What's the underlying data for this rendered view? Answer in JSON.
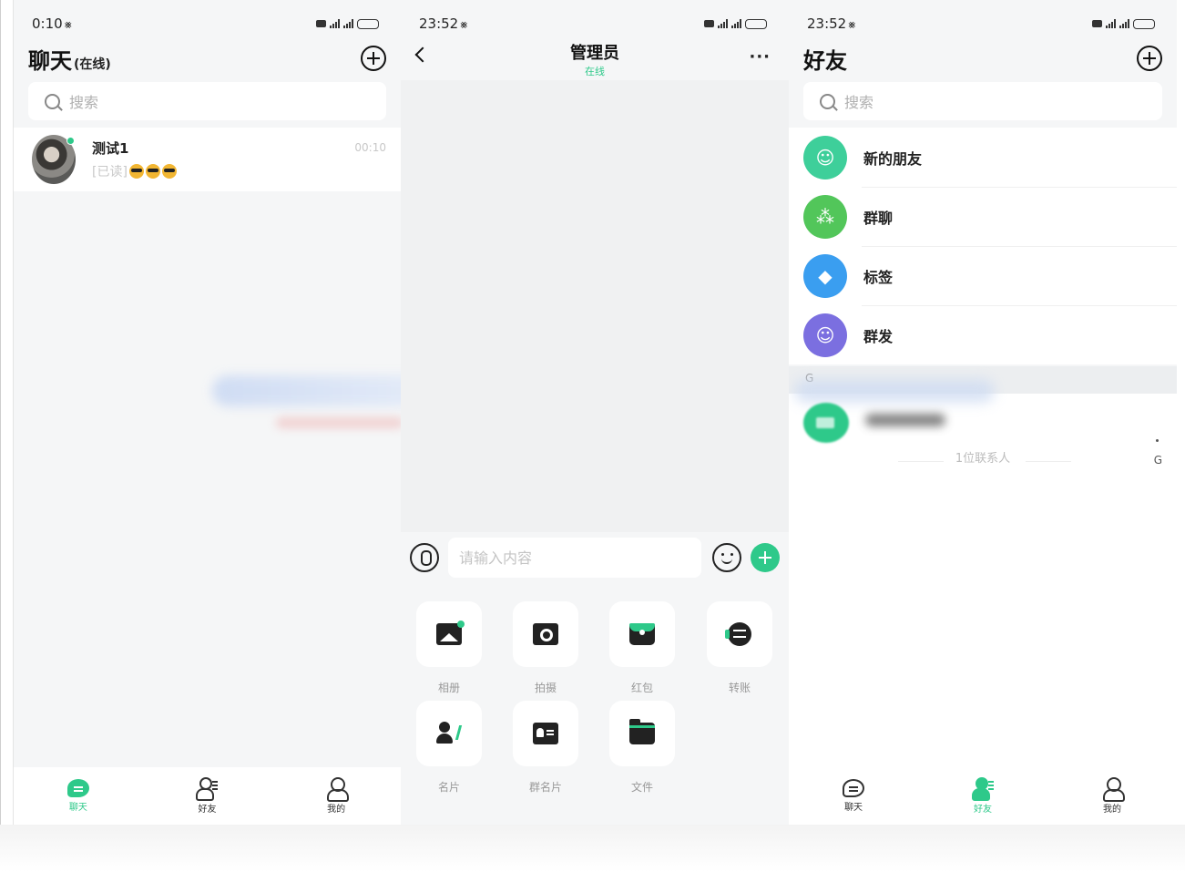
{
  "panel1": {
    "status": {
      "time": "0:10"
    },
    "title": "聊天",
    "subtitle": "(在线)",
    "search_placeholder": "搜索",
    "chat": {
      "name": "测试1",
      "time": "00:10",
      "read_tag": "[已读]",
      "emojis": "😎😎😎"
    },
    "nav": [
      {
        "label": "聊天",
        "icon": "chat-icon",
        "active": true
      },
      {
        "label": "好友",
        "icon": "friends-icon",
        "active": false
      },
      {
        "label": "我的",
        "icon": "me-icon",
        "active": false
      }
    ]
  },
  "panel2": {
    "status": {
      "time": "23:52"
    },
    "title": "管理员",
    "subtitle": "在线",
    "input_placeholder": "请输入内容",
    "tools": [
      {
        "label": "相册",
        "icon": "album-icon"
      },
      {
        "label": "拍摄",
        "icon": "camera-icon"
      },
      {
        "label": "红包",
        "icon": "red-packet-icon"
      },
      {
        "label": "转账",
        "icon": "transfer-icon"
      },
      {
        "label": "名片",
        "icon": "contact-card-icon"
      },
      {
        "label": "群名片",
        "icon": "group-card-icon"
      },
      {
        "label": "文件",
        "icon": "file-icon"
      }
    ]
  },
  "panel3": {
    "status": {
      "time": "23:52"
    },
    "title": "好友",
    "search_placeholder": "搜索",
    "menu": [
      {
        "label": "新的朋友",
        "icon": "new-friend-icon",
        "color": "#3ecf9a"
      },
      {
        "label": "群聊",
        "icon": "group-chat-icon",
        "color": "#52c65a"
      },
      {
        "label": "标签",
        "icon": "tag-icon",
        "color": "#3a9ef0"
      },
      {
        "label": "群发",
        "icon": "broadcast-icon",
        "color": "#7b6fe0"
      }
    ],
    "section_letter": "G",
    "contact_count": "1位联系人",
    "index_letter": "G",
    "nav": [
      {
        "label": "聊天",
        "icon": "chat-icon",
        "active": false
      },
      {
        "label": "好友",
        "icon": "friends-icon",
        "active": true
      },
      {
        "label": "我的",
        "icon": "me-icon",
        "active": false
      }
    ]
  },
  "colors": {
    "accent": "#2ec98a",
    "background": "#f5f6f7"
  }
}
